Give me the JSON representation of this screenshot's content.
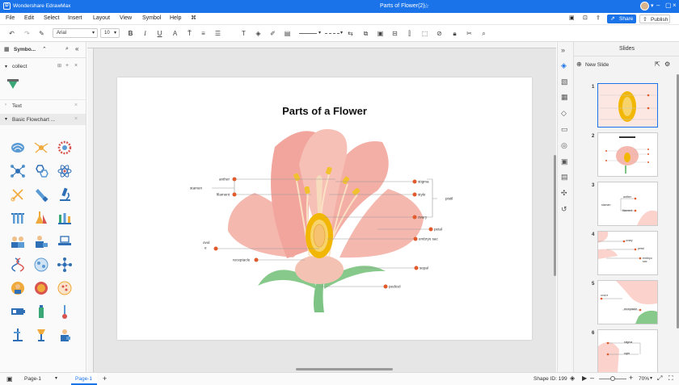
{
  "app": {
    "name": "Wondershare EdrawMax",
    "doc_title": "Parts of Flower(2)"
  },
  "header_actions": {
    "share": "Share",
    "publish": "Publish"
  },
  "menu": [
    "File",
    "Edit",
    "Select",
    "Insert",
    "Layout",
    "View",
    "Symbol",
    "Help"
  ],
  "toolbar": {
    "font": "Arial",
    "size": "10"
  },
  "left_panel": {
    "title": "Symbo...",
    "collect": "collect",
    "text_section": "Text",
    "basic_section": "Basic Flowchart ..."
  },
  "diagram": {
    "title": "Parts of a Flower",
    "labels": {
      "anther": "anther",
      "stamen": "stamen",
      "filament": "filament",
      "stigma": "stigma",
      "style": "style",
      "pistil": "pistil",
      "ovary": "ovary",
      "petal": "petal",
      "embryo_sac": "embryo sac",
      "ovule_1": "ovul",
      "ovule_2": "e",
      "receptacle": "receptacle",
      "sepal": "sepal",
      "pedicel": "pedicel"
    }
  },
  "right_panel": {
    "title": "Slides",
    "new_slide": "New Slide"
  },
  "slides": [
    {
      "num": "1",
      "labels": []
    },
    {
      "num": "2",
      "labels": []
    },
    {
      "num": "3",
      "labels": [
        "anther",
        "filament",
        "stamen"
      ]
    },
    {
      "num": "4",
      "labels": [
        "ovary",
        "petal",
        "embryo sac"
      ]
    },
    {
      "num": "5",
      "labels": [
        "ovul e",
        "receptacle"
      ]
    },
    {
      "num": "6",
      "labels": [
        "stigma",
        "style"
      ]
    }
  ],
  "status": {
    "page_select": "Page-1",
    "page_tab": "Page-1",
    "add": "+",
    "shape_id": "Shape ID: 199",
    "zoom": "70%"
  },
  "colors": {
    "accent": "#1a73e8",
    "petal": "#f4a9a0",
    "ovary": "#f2b705",
    "sepal": "#7dc383",
    "marker": "#e05a2b"
  }
}
